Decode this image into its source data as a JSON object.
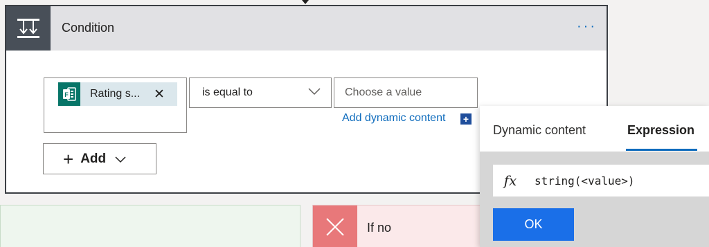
{
  "condition": {
    "title": "Condition",
    "more_label": "···",
    "operand": {
      "token_label": "Rating s...",
      "token_icon": "forms-icon",
      "remove_label": "✕"
    },
    "operator": {
      "selected": "is equal to",
      "chevron_icon": "chevron-down-icon"
    },
    "value": {
      "placeholder": "Choose a value"
    },
    "add_dynamic": {
      "label": "Add dynamic content",
      "icon_glyph": "+"
    },
    "add_button": {
      "plus_glyph": "+",
      "label": "Add"
    }
  },
  "branches": {
    "no_label": "If no"
  },
  "popup": {
    "tabs": [
      {
        "label": "Dynamic content"
      },
      {
        "label": "Expression"
      }
    ],
    "active_tab": "Expression",
    "fx_label": "fx",
    "expression_value": "string(<value>)",
    "ok_label": "OK"
  },
  "colors": {
    "header_icon_bg": "#484f58",
    "token_icon_bg": "#077568",
    "link": "#0f6cbd",
    "ok_button": "#1a6fe8",
    "no_branch_icon": "#e8787a"
  }
}
